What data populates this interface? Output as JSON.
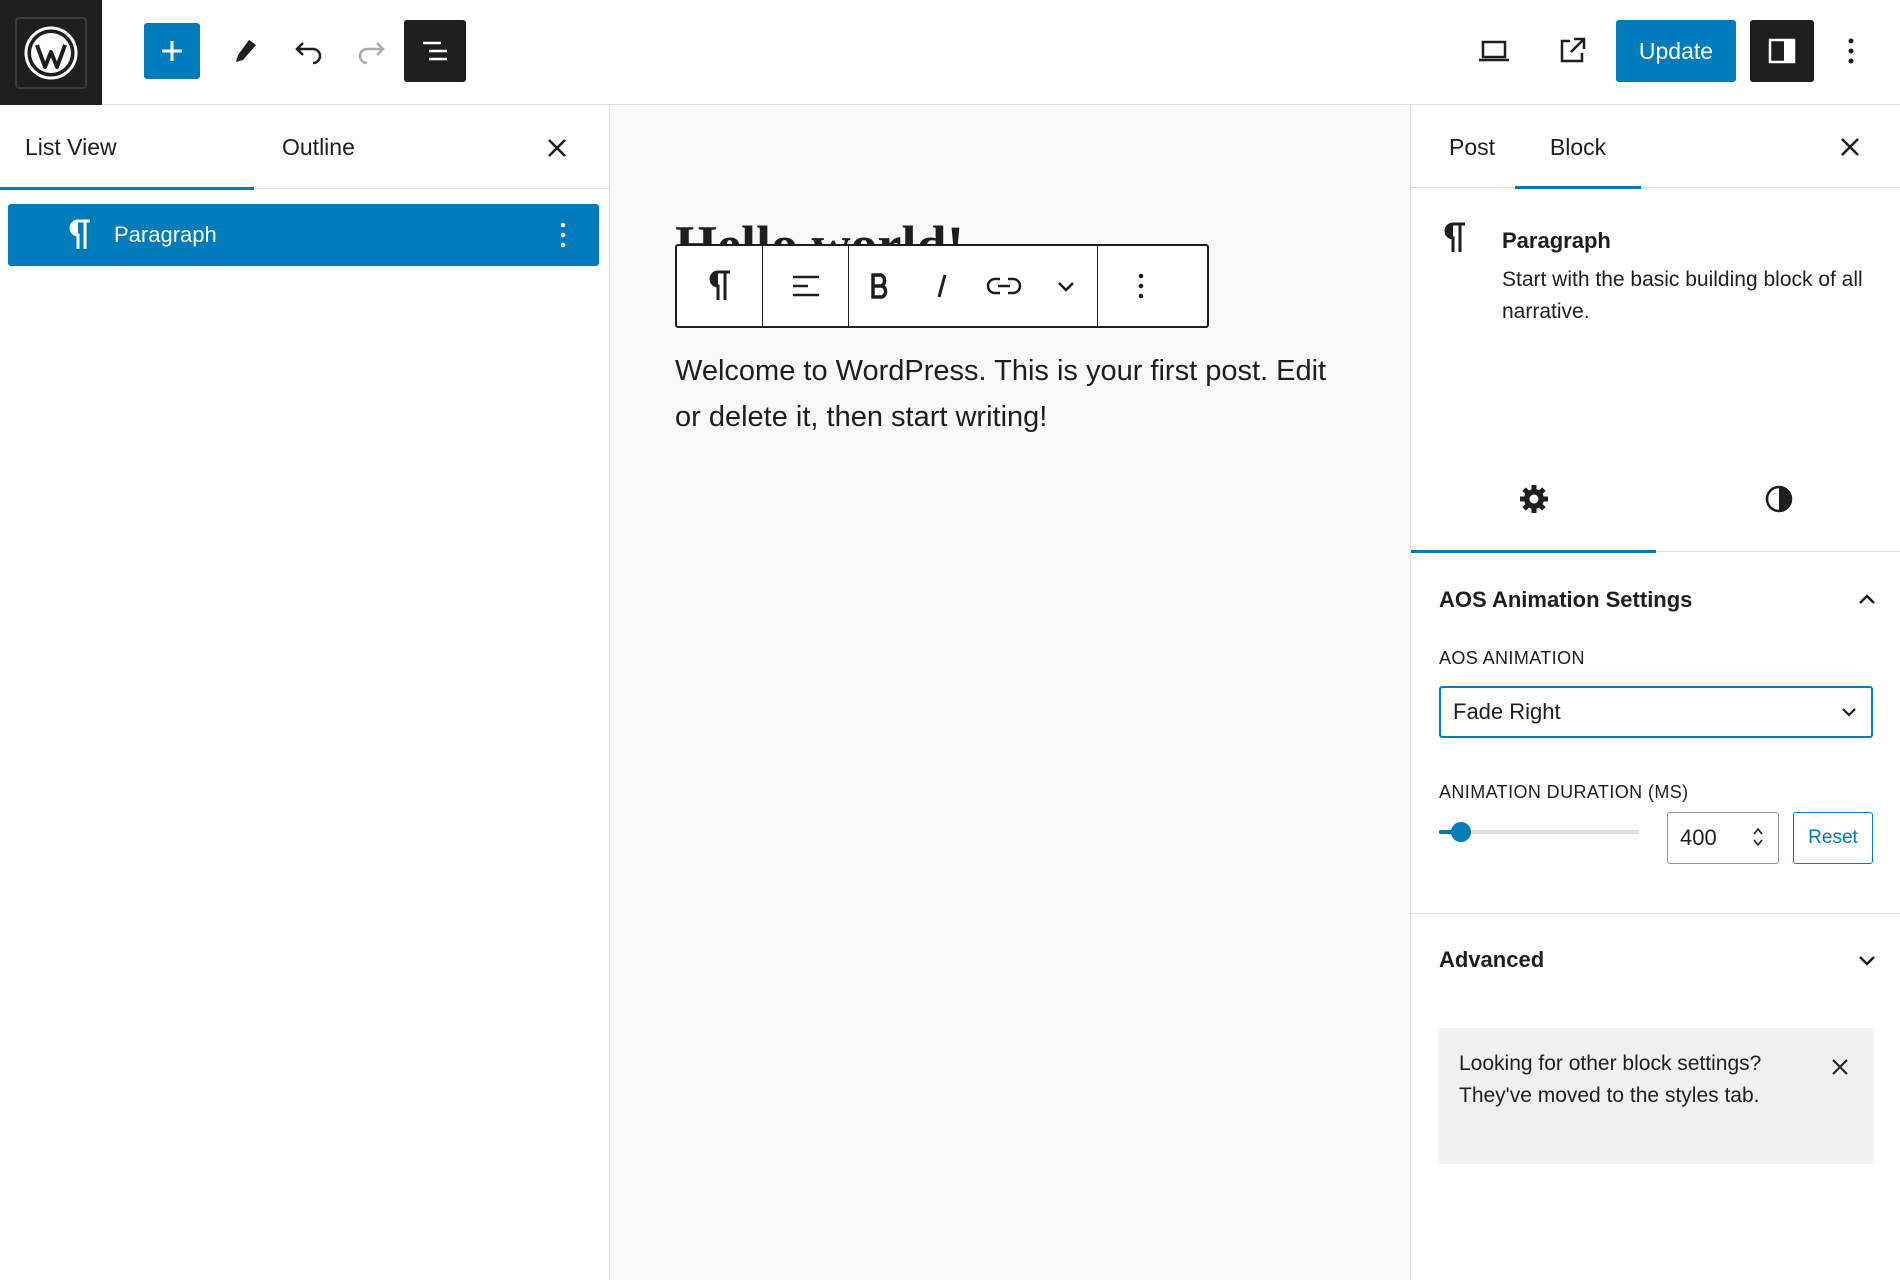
{
  "header": {
    "update_label": "Update"
  },
  "list_view": {
    "tab_list": "List View",
    "tab_outline": "Outline",
    "items": [
      {
        "label": "Paragraph"
      }
    ]
  },
  "canvas": {
    "title": "Hello world!",
    "body": "Welcome to WordPress. This is your first post. Edit or delete it, then start writing!"
  },
  "sidebar": {
    "tab_post": "Post",
    "tab_block": "Block",
    "block_name": "Paragraph",
    "block_description": "Start with the basic building block of all narrative.",
    "aos_panel_title": "AOS Animation Settings",
    "aos_animation_label": "AOS ANIMATION",
    "aos_animation_value": "Fade Right",
    "duration_label": "ANIMATION DURATION (MS)",
    "duration_value": "400",
    "duration_slider_fraction": 0.11,
    "reset_label": "Reset",
    "advanced_title": "Advanced",
    "notice_text": "Looking for other block settings? They've moved to the styles tab."
  },
  "colors": {
    "accent": "#007cba",
    "dark": "#1e1e1e",
    "canvas_bg": "#f9f9f9",
    "notice_bg": "#f0f0f0"
  }
}
